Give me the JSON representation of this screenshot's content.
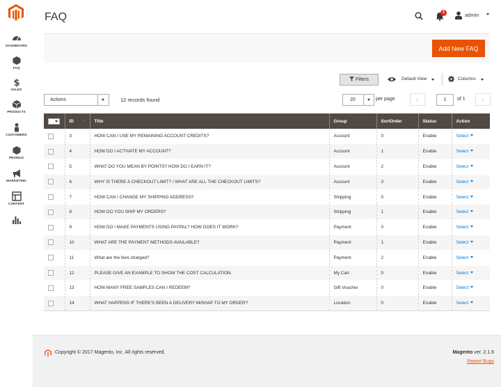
{
  "sidebar": {
    "items": [
      {
        "label": "DASHBOARD",
        "icon": "speedometer-icon"
      },
      {
        "label": "FAQ",
        "icon": "hexagon-icon"
      },
      {
        "label": "SALES",
        "icon": "dollar-icon"
      },
      {
        "label": "PRODUCTS",
        "icon": "box-icon"
      },
      {
        "label": "CUSTOMERS",
        "icon": "person-icon"
      },
      {
        "label": "PROMAG",
        "icon": "hexagon-icon"
      },
      {
        "label": "MARKETING",
        "icon": "megaphone-icon"
      },
      {
        "label": "CONTENT",
        "icon": "layout-icon"
      },
      {
        "label": "",
        "icon": "bar-chart-icon"
      }
    ]
  },
  "header": {
    "title": "FAQ",
    "notifications_count": "1",
    "username": "admin"
  },
  "toolbar": {
    "add_label": "Add New FAQ",
    "filters_label": "Filters",
    "view_label": "Default View",
    "columns_label": "Columns",
    "actions_value": "Actions",
    "records_found": "12 records found",
    "per_page_value": "20",
    "per_page_label": "per page",
    "page_current": "1",
    "page_of": "of 1"
  },
  "grid": {
    "columns": [
      "ID",
      "Title",
      "Group",
      "SortOrder",
      "Status",
      "Action"
    ],
    "rows": [
      {
        "id": "3",
        "title": "HOW CAN I USE MY REMAINING ACCOUNT CREDITS?",
        "group": "Account",
        "sort": "0",
        "status": "Enable",
        "action": "Select"
      },
      {
        "id": "4",
        "title": "HOW DO I ACTIVATE MY ACCOUNT?",
        "group": "Account",
        "sort": "1",
        "status": "Enable",
        "action": "Select"
      },
      {
        "id": "5",
        "title": "WHAT DO YOU MEAN BY POINTS? HOW DO I EARN IT?",
        "group": "Account",
        "sort": "2",
        "status": "Enable",
        "action": "Select"
      },
      {
        "id": "6",
        "title": "WHY IS THERE A CHECKOUT LIMIT? / WHAT ARE ALL THE CHECKOUT LIMITS?",
        "group": "Account",
        "sort": "3",
        "status": "Enable",
        "action": "Select"
      },
      {
        "id": "7",
        "title": "HOW CAN I CHANGE MY SHIPPING ADDRESS?",
        "group": "Shipping",
        "sort": "0",
        "status": "Enable",
        "action": "Select"
      },
      {
        "id": "8",
        "title": "HOW DO YOU SHIP MY ORDERS?",
        "group": "Shipping",
        "sort": "1",
        "status": "Enable",
        "action": "Select"
      },
      {
        "id": "9",
        "title": "HOW DO I MAKE PAYMENTS USING PAYPAL? HOW DOES IT WORK?",
        "group": "Payment",
        "sort": "0",
        "status": "Enable",
        "action": "Select"
      },
      {
        "id": "10",
        "title": "WHAT ARE THE PAYMENT METHODS AVAILABLE?",
        "group": "Payment",
        "sort": "1",
        "status": "Enable",
        "action": "Select"
      },
      {
        "id": "11",
        "title": "What are the fees charged?",
        "group": "Payment",
        "sort": "2",
        "status": "Enable",
        "action": "Select"
      },
      {
        "id": "12",
        "title": "PLEASE GIVE AN EXAMPLE TO SHOW THE COST CALCULATION.",
        "group": "My Cart",
        "sort": "0",
        "status": "Enable",
        "action": "Select"
      },
      {
        "id": "13",
        "title": "HOW MANY FREE SAMPLES CAN I REDEEM?",
        "group": "Gift Voucher",
        "sort": "0",
        "status": "Enable",
        "action": "Select"
      },
      {
        "id": "14",
        "title": "WHAT HAPPENS IF THERE'S BEEN A DELIVERY MISHAP TO MY ORDER?",
        "group": "Location",
        "sort": "0",
        "status": "Enable",
        "action": "Select"
      }
    ]
  },
  "footer": {
    "copyright": "Copyright © 2017 Magento, Inc. All rights reserved.",
    "version_brand": "Magento",
    "version_text": " ver. 2.1.6",
    "report_bugs": "Report Bugs"
  },
  "colors": {
    "accent": "#eb5202",
    "header_dark": "#514943",
    "link": "#007bdb"
  }
}
